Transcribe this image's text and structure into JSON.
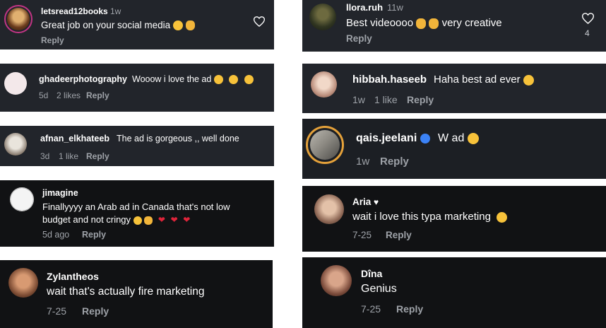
{
  "comments": [
    {
      "user": "letsread12books",
      "time": "1w",
      "text": "Great job on your social media",
      "reply": "Reply"
    },
    {
      "user": "ghadeerphotography",
      "text": "Wooow i love the ad",
      "time": "5d",
      "likes": "2 likes",
      "reply": "Reply"
    },
    {
      "user": "afnan_elkhateeb",
      "text": "The ad is gorgeous ,, well done",
      "time": "3d",
      "likes": "1 like",
      "reply": "Reply"
    },
    {
      "user": "jimagine",
      "text1": "Finallyyyy an Arab ad in Canada that's not low",
      "text2": "budget and not cringy",
      "time": "5d ago",
      "reply": "Reply"
    },
    {
      "user": "Zylantheos",
      "text": "wait that's actually fire marketing",
      "time": "7-25",
      "reply": "Reply"
    },
    {
      "user": "llora.ruh",
      "time": "11w",
      "text1": "Best videoooo",
      "text2": "very creative",
      "reply": "Reply",
      "likes": "4"
    },
    {
      "user": "hibbah.haseeb",
      "text": "Haha best ad ever",
      "time": "1w",
      "likes": "1 like",
      "reply": "Reply"
    },
    {
      "user": "qais.jeelani",
      "text": "W ad",
      "time": "1w",
      "reply": "Reply"
    },
    {
      "user": "Aria",
      "text": "wait i love this typa marketing",
      "time": "7-25",
      "reply": "Reply"
    },
    {
      "user": "Dîna",
      "text": "Genius",
      "time": "7-25",
      "reply": "Reply"
    }
  ],
  "colors": {
    "card": "#22252b",
    "card_black": "#111214",
    "muted": "#9ea2a8",
    "heart_red": "#e0243a",
    "verified": "#3b82f6"
  },
  "icons": [
    "heart-outline-icon",
    "verified-badge-icon",
    "emoji-icon"
  ]
}
